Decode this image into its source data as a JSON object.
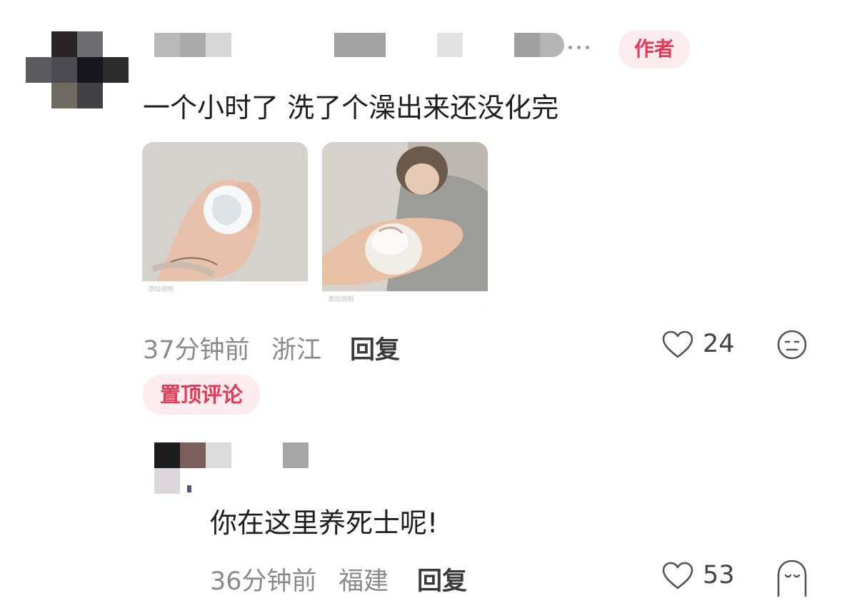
{
  "comment": {
    "author_badge": "作者",
    "text": "一个小时了 洗了个澡出来还没化完",
    "images": [
      {
        "caption": "添加说明",
        "subject": "hand holding melting ice ball"
      },
      {
        "caption": "添加说明",
        "subject": "person holding melting ice ball"
      }
    ],
    "time": "37分钟前",
    "location": "浙江",
    "reply_label": "回复",
    "likes": "24",
    "pinned_badge": "置顶评论"
  },
  "reply": {
    "text": "你在这里养死士呢!",
    "time": "36分钟前",
    "location": "福建",
    "reply_label": "回复",
    "likes": "53"
  },
  "colors": {
    "accent": "#e23a57",
    "badge_bg": "#fdecef",
    "meta_text": "#8a8a8a"
  },
  "icons": {
    "like": "heart-outline-icon",
    "react": "emoji-face-icon",
    "react_reply": "ghost-face-icon"
  }
}
